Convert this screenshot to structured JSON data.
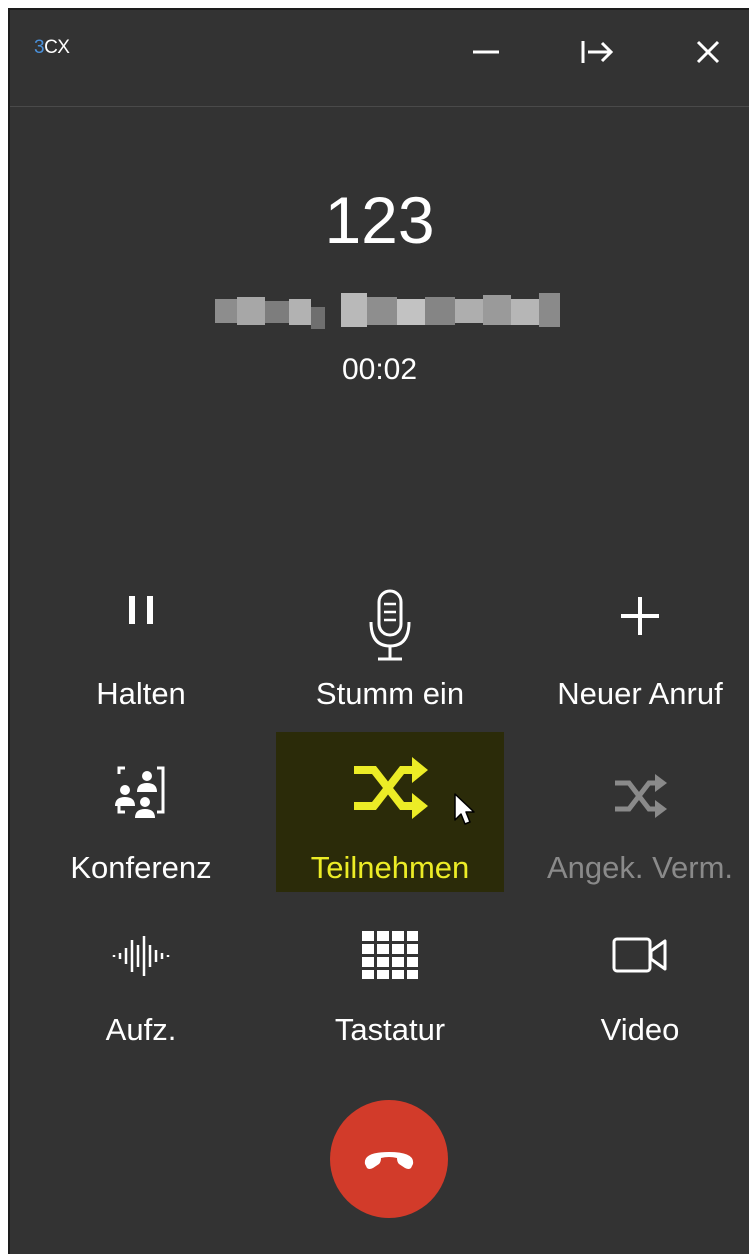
{
  "app": {
    "logo_prefix": "3",
    "logo_suffix": "CX"
  },
  "titlebar": {
    "minimize_icon": "minimize-icon",
    "popout_icon": "popout-icon",
    "close_icon": "close-icon"
  },
  "call": {
    "number": "123",
    "caller_name": "",
    "duration": "00:02"
  },
  "actions": [
    {
      "label": "Halten",
      "icon": "pause-icon"
    },
    {
      "label": "Stumm ein",
      "icon": "microphone-icon"
    },
    {
      "label": "Neuer Anruf",
      "icon": "plus-icon"
    },
    {
      "label": "Konferenz",
      "icon": "conference-icon"
    },
    {
      "label": "Teilnehmen",
      "icon": "shuffle-icon",
      "state": "highlighted"
    },
    {
      "label": "Angek. Verm.",
      "icon": "shuffle-icon",
      "state": "disabled"
    },
    {
      "label": "Aufz.",
      "icon": "soundwave-icon"
    },
    {
      "label": "Tastatur",
      "icon": "keypad-icon"
    },
    {
      "label": "Video",
      "icon": "video-camera-icon"
    }
  ],
  "hangup": {
    "icon": "hangup-phone-icon"
  },
  "colors": {
    "background": "#333333",
    "highlight_bg": "#2b2b09",
    "highlight_text": "#ecec26",
    "disabled_text": "#8a8a8a",
    "hangup_red": "#d23b2a",
    "logo_accent": "#4a90d9"
  }
}
